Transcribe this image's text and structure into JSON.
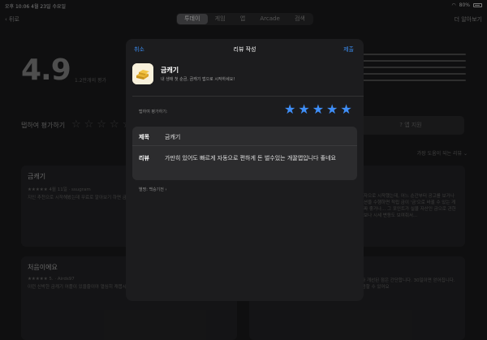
{
  "status_bar": {
    "time": "오후 10:06",
    "date": "4월 23일 수요일",
    "battery": "80%"
  },
  "nav": {
    "back_label": "뒤로",
    "segments": [
      "투데이",
      "게임",
      "앱",
      "Arcade",
      "검색"
    ],
    "active_segment": "투데이",
    "more_label": "더 알아보기"
  },
  "ratings": {
    "score": "4.9",
    "count": "1.2만개의 평가",
    "tap_to_rate": "탭하여 평가하기",
    "app_support": "앱 지원",
    "sort": "가장 도움이 되는 리뷰 ⌄"
  },
  "background_reviews": [
    {
      "title": "금캐기",
      "meta": "★★★★★ 4월 11일 · ssugram",
      "body": "지인 추천으로 시작해봤는데 무료로 알아보기 하면 금 살 수 있어서 좋아요!"
    },
    {
      "title": "",
      "meta": "",
      "body": "성자으로 시작했는데, 어느 순간부터 공고를 보거나 미션을 수행하면 적립 금이 '금'으로 바뀔 수 있는 게 진짜 좋거나... 그 포인트가 실물 자산인 금으로 관한 정보나 시세 변동도 보여줘서..."
    },
    {
      "title": "처음이에요",
      "meta": "★★★★★ 5. · Airds97",
      "body": "이런 신박한 금캐기 어플이 있을줄이야 열심히 캐봅시다"
    },
    {
      "title": "",
      "meta": "",
      "body": "구산업으로 만약 챌린프로제공합으로 사용하는 챌린지 보다 개선된 점은 간단합니다. 30일이면 얻어집니다. 천구초대로 평균40 일으로 유지되는 가장 이자없이 ... 이용할 수 있어요"
    }
  ],
  "sheet": {
    "cancel": "취소",
    "title": "리뷰 작성",
    "submit": "제출",
    "app_name": "금캐기",
    "app_desc": "내 생애 첫 순금, 금캐기 앱으로 시작하세요!",
    "tap_label": "탭하여 평가하기:",
    "rating": 5,
    "title_label": "제목",
    "title_value": "금캐기",
    "review_label": "리뷰",
    "review_value": "가만히 있어도 빠르게 자동으로 편하게 돈 벌수있는 개꿀앱입니다 좋네요",
    "edit_label": "별명: 백승기전 ›"
  },
  "colors": {
    "accent": "#3f8ef7",
    "sheet_bg": "#1c1c1e",
    "field_bg": "#2c2c2e"
  }
}
